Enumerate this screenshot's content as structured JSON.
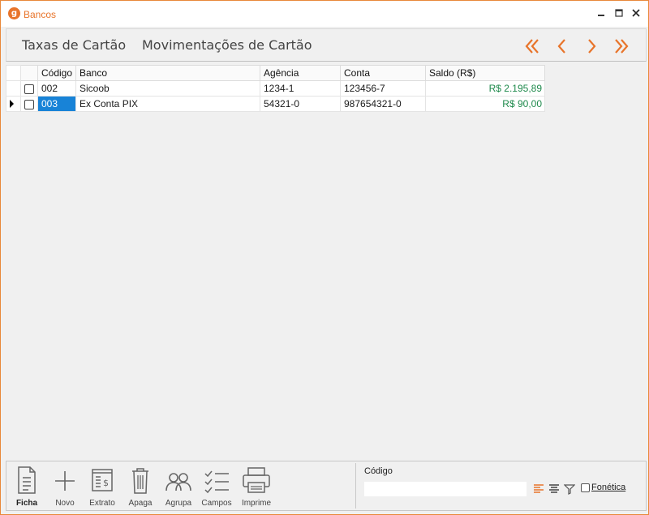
{
  "window": {
    "title": "Bancos",
    "app_icon_glyph": "g",
    "accent": "#e8742a"
  },
  "tabs": [
    {
      "label": "Taxas de Cartão"
    },
    {
      "label": "Movimentações de Cartão"
    }
  ],
  "nav": [
    "first-icon",
    "previous-icon",
    "next-icon",
    "last-icon"
  ],
  "grid": {
    "columns": [
      "",
      "",
      "Código",
      "Banco",
      "Agência",
      "Conta",
      "Saldo (R$)"
    ],
    "rows": [
      {
        "codigo": "002",
        "banco": "Sicoob",
        "agencia": "1234-1",
        "conta": "123456-7",
        "saldo": "R$ 2.195,89",
        "current": false
      },
      {
        "codigo": "003",
        "banco": "Ex Conta PIX",
        "agencia": "54321-0",
        "conta": "987654321-0",
        "saldo": "R$ 90,00",
        "current": true
      }
    ],
    "money_color": "#1f8a4c",
    "selection_color": "#1883d7"
  },
  "toolbar": {
    "ficha": "Ficha",
    "novo": "Novo",
    "extrato": "Extrato",
    "apaga": "Apaga",
    "agrupa": "Agrupa",
    "campos": "Campos",
    "imprime": "Imprime"
  },
  "search": {
    "label": "Código",
    "value": "",
    "fonetica_label": "Fonética",
    "fonetica_checked": false
  }
}
